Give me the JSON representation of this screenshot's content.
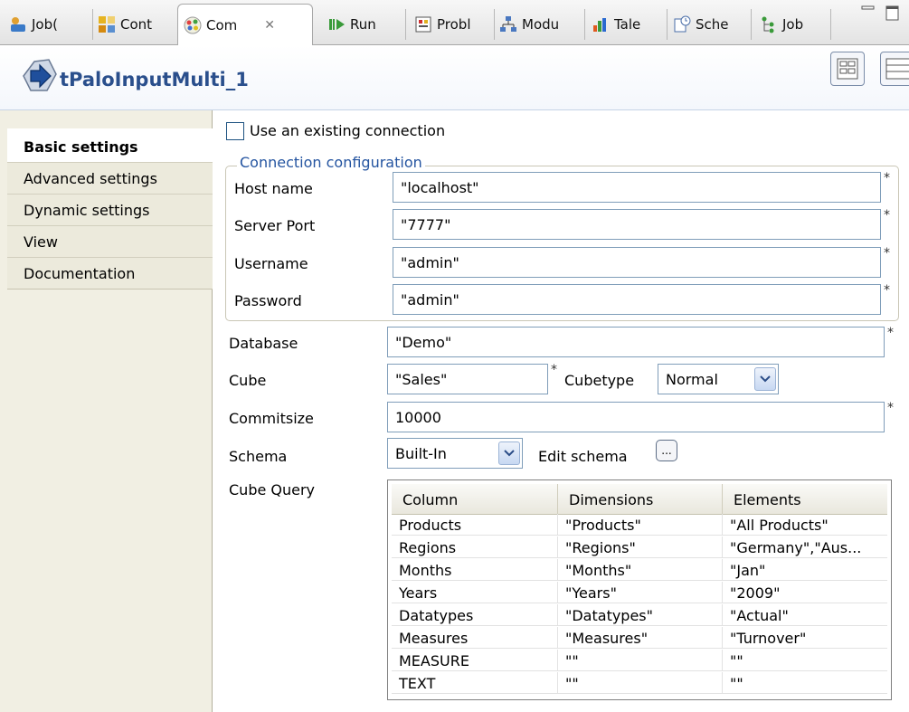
{
  "tabs": [
    {
      "label": "Job(",
      "icon": "job-tab-icon"
    },
    {
      "label": "Cont",
      "icon": "contexts-icon"
    },
    {
      "label": "Com",
      "icon": "component-icon",
      "active": true
    },
    {
      "label": "Run",
      "icon": "run-icon"
    },
    {
      "label": "Probl",
      "icon": "problems-icon"
    },
    {
      "label": "Modu",
      "icon": "modules-icon"
    },
    {
      "label": "Tale",
      "icon": "talend-icon"
    },
    {
      "label": "Sche",
      "icon": "scheduler-icon"
    },
    {
      "label": "Job",
      "icon": "job-hierarchy-icon"
    }
  ],
  "tab_close_glyph": "✕",
  "component": {
    "title": "tPaloInputMulti_1"
  },
  "nav": {
    "items": [
      {
        "label": "Basic settings",
        "active": true
      },
      {
        "label": "Advanced settings"
      },
      {
        "label": "Dynamic settings"
      },
      {
        "label": "View"
      },
      {
        "label": "Documentation"
      }
    ]
  },
  "form": {
    "use_existing_connection": {
      "label": "Use an existing connection",
      "checked": false
    },
    "connection_group": {
      "legend": "Connection configuration"
    },
    "host": {
      "label": "Host name",
      "value": "\"localhost\""
    },
    "port": {
      "label": "Server Port",
      "value": "\"7777\""
    },
    "username": {
      "label": "Username",
      "value": "\"admin\""
    },
    "password": {
      "label": "Password",
      "value": "\"admin\""
    },
    "database": {
      "label": "Database",
      "value": "\"Demo\""
    },
    "cube": {
      "label": "Cube",
      "value": "\"Sales\""
    },
    "cubetype": {
      "label": "Cubetype",
      "value": "Normal"
    },
    "commitsize": {
      "label": "Commitsize",
      "value": "10000"
    },
    "schema": {
      "label": "Schema",
      "value": "Built-In"
    },
    "edit_schema": {
      "label": "Edit schema",
      "button": "..."
    },
    "cube_query": {
      "label": "Cube Query"
    },
    "required_mark": "*"
  },
  "table": {
    "columns": [
      "Column",
      "Dimensions",
      "Elements"
    ],
    "rows": [
      [
        "Products",
        "\"Products\"",
        "\"All Products\""
      ],
      [
        "Regions",
        "\"Regions\"",
        "\"Germany\",\"Aus..."
      ],
      [
        "Months",
        "\"Months\"",
        "\"Jan\""
      ],
      [
        "Years",
        "\"Years\"",
        "\"2009\""
      ],
      [
        "Datatypes",
        "\"Datatypes\"",
        "\"Actual\""
      ],
      [
        "Measures",
        "\"Measures\"",
        "\"Turnover\""
      ],
      [
        "MEASURE",
        "\"\"",
        "\"\""
      ],
      [
        "TEXT",
        "\"\"",
        "\"\""
      ]
    ]
  }
}
